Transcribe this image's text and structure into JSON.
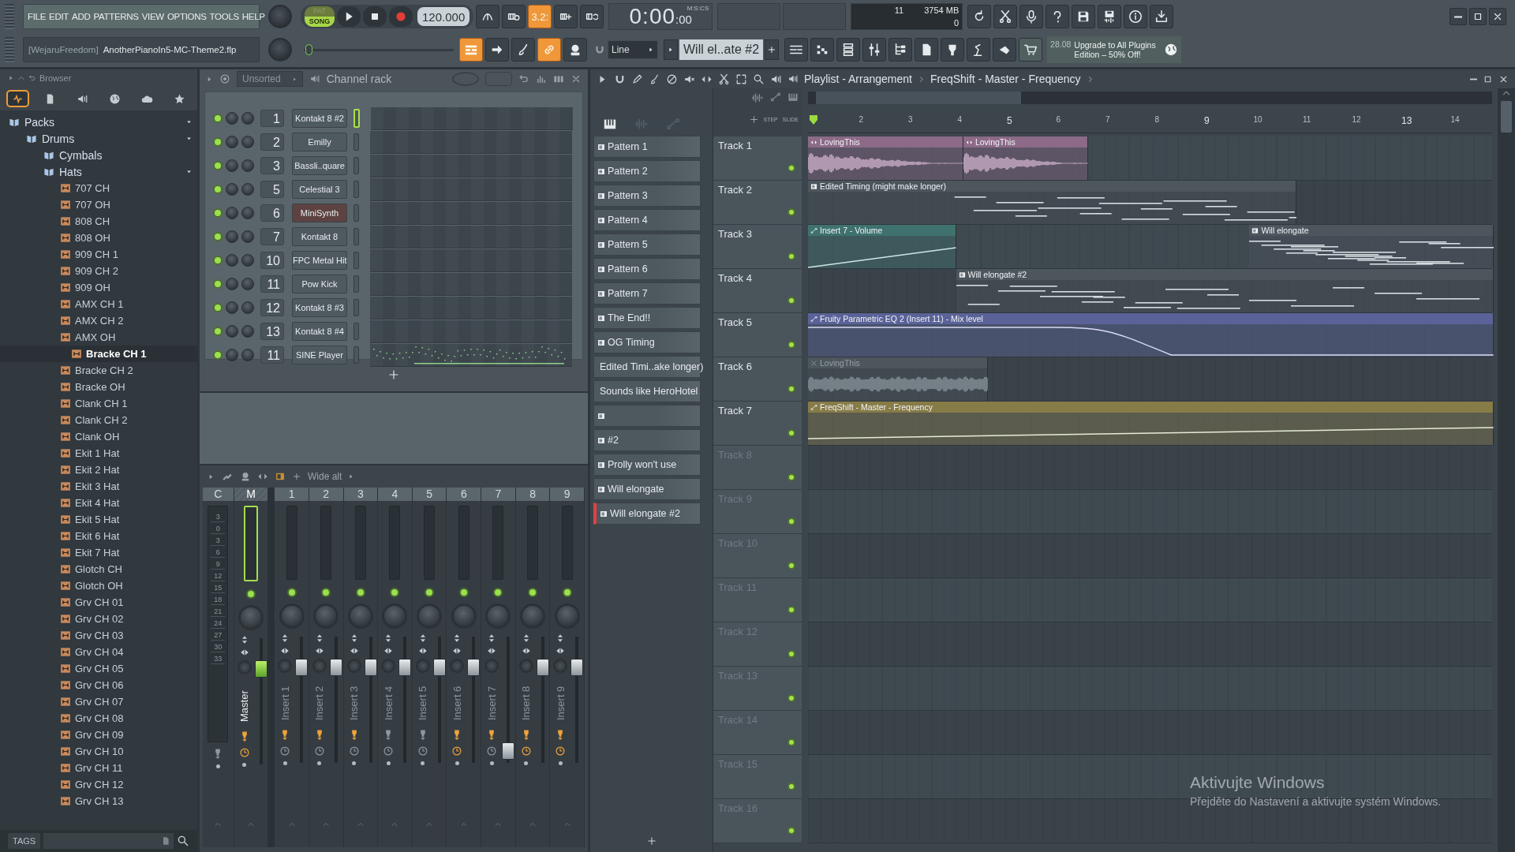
{
  "menu": [
    "FILE",
    "EDIT",
    "ADD",
    "PATTERNS",
    "VIEW",
    "OPTIONS",
    "TOOLS",
    "HELP"
  ],
  "project": {
    "author": "[WejaruFreedom]",
    "file": "AnotherPianoIn5-MC-Theme2.flp"
  },
  "transport": {
    "modes": [
      {
        "label": "PAT",
        "selected": false
      },
      {
        "label": "SONG",
        "selected": true
      }
    ],
    "tempo": "120.000"
  },
  "recording_buttons": [
    {
      "on": false
    },
    {
      "on": false
    },
    {
      "on": true,
      "label": "3.2:"
    },
    {
      "on": false
    },
    {
      "on": false
    }
  ],
  "clock": {
    "time": "0:00",
    "centiseconds": ":00",
    "format": "M:S:CS"
  },
  "monitor": {
    "cpu": "11",
    "memory": "3754 MB",
    "polyphony": "0"
  },
  "tool_buttons": [
    {
      "on": true
    },
    {
      "on": false
    },
    {
      "on": false
    },
    {
      "on": true
    },
    {
      "on": false
    }
  ],
  "snap": "Line",
  "pattern": "Will el..ate #2",
  "panel_buttons": [
    {
      "on": false
    },
    {
      "on": false
    },
    {
      "on": false
    },
    {
      "on": false
    },
    {
      "on": false
    },
    {
      "on": false
    },
    {
      "on": false
    },
    {
      "on": false
    },
    {
      "on": false
    },
    {
      "on": true
    }
  ],
  "news": {
    "date": "28.08",
    "text": "Upgrade to All Plugins Edition – 50% Off!"
  },
  "browser": {
    "title": "Browser",
    "tabs": [
      {
        "selected": true
      },
      {
        "selected": false
      },
      {
        "selected": false
      },
      {
        "selected": false
      },
      {
        "selected": false
      },
      {
        "selected": false
      }
    ],
    "tree": [
      {
        "label": "Packs",
        "kind": "folder",
        "expanded": true,
        "children": [
          {
            "label": "Drums",
            "kind": "folder",
            "expanded": true,
            "children": [
              {
                "label": "Cymbals",
                "kind": "folder",
                "expanded": false
              },
              {
                "label": "Hats",
                "kind": "folder",
                "expanded": true,
                "children": [
                  {
                    "label": "707 CH",
                    "kind": "file",
                    "selected": false
                  },
                  {
                    "label": "707 OH",
                    "kind": "file",
                    "selected": false
                  },
                  {
                    "label": "808 CH",
                    "kind": "file",
                    "selected": false
                  },
                  {
                    "label": "808 OH",
                    "kind": "file",
                    "selected": false
                  },
                  {
                    "label": "909 CH 1",
                    "kind": "file",
                    "selected": false
                  },
                  {
                    "label": "909 CH 2",
                    "kind": "file",
                    "selected": false
                  },
                  {
                    "label": "909 OH",
                    "kind": "file",
                    "selected": false
                  },
                  {
                    "label": "AMX CH 1",
                    "kind": "file",
                    "selected": false
                  },
                  {
                    "label": "AMX CH 2",
                    "kind": "file",
                    "selected": false
                  },
                  {
                    "label": "AMX OH",
                    "kind": "file",
                    "selected": false
                  },
                  {
                    "label": "Bracke CH 1",
                    "kind": "file",
                    "selected": true
                  },
                  {
                    "label": "Bracke CH 2",
                    "kind": "file",
                    "selected": false
                  },
                  {
                    "label": "Bracke OH",
                    "kind": "file",
                    "selected": false
                  },
                  {
                    "label": "Clank CH 1",
                    "kind": "file",
                    "selected": false
                  },
                  {
                    "label": "Clank CH 2",
                    "kind": "file",
                    "selected": false
                  },
                  {
                    "label": "Clank OH",
                    "kind": "file",
                    "selected": false
                  },
                  {
                    "label": "Ekit 1 Hat",
                    "kind": "file",
                    "selected": false
                  },
                  {
                    "label": "Ekit 2 Hat",
                    "kind": "file",
                    "selected": false
                  },
                  {
                    "label": "Ekit 3 Hat",
                    "kind": "file",
                    "selected": false
                  },
                  {
                    "label": "Ekit 4 Hat",
                    "kind": "file",
                    "selected": false
                  },
                  {
                    "label": "Ekit 5 Hat",
                    "kind": "file",
                    "selected": false
                  },
                  {
                    "label": "Ekit 6 Hat",
                    "kind": "file",
                    "selected": false
                  },
                  {
                    "label": "Ekit 7 Hat",
                    "kind": "file",
                    "selected": false
                  },
                  {
                    "label": "Glotch CH",
                    "kind": "file",
                    "selected": false
                  },
                  {
                    "label": "Glotch OH",
                    "kind": "file",
                    "selected": false
                  },
                  {
                    "label": "Grv CH 01",
                    "kind": "file",
                    "selected": false
                  },
                  {
                    "label": "Grv CH 02",
                    "kind": "file",
                    "selected": false
                  },
                  {
                    "label": "Grv CH 03",
                    "kind": "file",
                    "selected": false
                  },
                  {
                    "label": "Grv CH 04",
                    "kind": "file",
                    "selected": false
                  },
                  {
                    "label": "Grv CH 05",
                    "kind": "file",
                    "selected": false
                  },
                  {
                    "label": "Grv CH 06",
                    "kind": "file",
                    "selected": false
                  },
                  {
                    "label": "Grv CH 07",
                    "kind": "file",
                    "selected": false
                  },
                  {
                    "label": "Grv CH 08",
                    "kind": "file",
                    "selected": false
                  },
                  {
                    "label": "Grv CH 09",
                    "kind": "file",
                    "selected": false
                  },
                  {
                    "label": "Grv CH 10",
                    "kind": "file",
                    "selected": false
                  },
                  {
                    "label": "Grv CH 11",
                    "kind": "file",
                    "selected": false
                  },
                  {
                    "label": "Grv CH 12",
                    "kind": "file",
                    "selected": false
                  },
                  {
                    "label": "Grv CH 13",
                    "kind": "file",
                    "selected": false
                  }
                ]
              }
            ]
          }
        ]
      }
    ],
    "tags_label": "TAGS"
  },
  "channel_rack": {
    "title": "Channel rack",
    "filter": "Unsorted",
    "channels": [
      {
        "number": "1",
        "name": "Kontakt 8 #2",
        "on": true,
        "selected": true,
        "color": "#4f5960"
      },
      {
        "number": "2",
        "name": "Emilly",
        "on": true,
        "selected": false,
        "color": "#4f5960"
      },
      {
        "number": "3",
        "name": "Bassli..quare",
        "on": true,
        "selected": false,
        "color": "#4f5960"
      },
      {
        "number": "5",
        "name": "Celestial 3",
        "on": true,
        "selected": false,
        "color": "#4f5960"
      },
      {
        "number": "6",
        "name": "MiniSynth",
        "on": true,
        "selected": false,
        "color": "#5e4241"
      },
      {
        "number": "7",
        "name": "Kontakt 8",
        "on": true,
        "selected": false,
        "color": "#4f5960"
      },
      {
        "number": "10",
        "name": "FPC Metal Hit",
        "on": true,
        "selected": false,
        "color": "#4f5960"
      },
      {
        "number": "11",
        "name": "Pow Kick",
        "on": true,
        "selected": false,
        "color": "#4f5960"
      },
      {
        "number": "12",
        "name": "Kontakt 8 #3",
        "on": true,
        "selected": false,
        "color": "#4f5960"
      },
      {
        "number": "13",
        "name": "Kontakt 8 #4",
        "on": true,
        "selected": false,
        "color": "#4f5960"
      },
      {
        "number": "11",
        "name": "SINE Player",
        "on": true,
        "selected": false,
        "color": "#4f5960",
        "kind": "notes"
      }
    ]
  },
  "mixer": {
    "preset": "Wide alt",
    "scale": [
      "3",
      "0",
      "3",
      "6",
      "9",
      "12",
      "15",
      "18",
      "21",
      "24",
      "27",
      "30",
      "33"
    ],
    "tracks": [
      {
        "label": "C",
        "kind": "current",
        "selected": false,
        "fx_on": false
      },
      {
        "label": "M",
        "name": "Master",
        "kind": "master",
        "selected": true,
        "level": 0.8,
        "fx_on": true,
        "clock_on": true
      },
      {
        "label": "1",
        "name": "Insert 1",
        "kind": "insert",
        "selected": false,
        "level": 0.8,
        "fx_on": true,
        "clock_on": false
      },
      {
        "label": "2",
        "name": "Insert 2",
        "kind": "insert",
        "selected": false,
        "level": 0.8,
        "fx_on": true,
        "clock_on": false
      },
      {
        "label": "3",
        "name": "Insert 3",
        "kind": "insert",
        "selected": false,
        "level": 0.8,
        "fx_on": true,
        "clock_on": false
      },
      {
        "label": "4",
        "name": "Insert 4",
        "kind": "insert",
        "selected": false,
        "level": 0.8,
        "fx_on": false,
        "clock_on": false
      },
      {
        "label": "5",
        "name": "Insert 5",
        "kind": "insert",
        "selected": false,
        "level": 0.8,
        "fx_on": false,
        "clock_on": false
      },
      {
        "label": "6",
        "name": "Insert 6",
        "kind": "insert",
        "selected": false,
        "level": 0.8,
        "fx_on": true,
        "clock_on": true
      },
      {
        "label": "7",
        "name": "Insert 7",
        "kind": "insert",
        "selected": false,
        "level": 0.03,
        "fx_on": true,
        "clock_on": false
      },
      {
        "label": "8",
        "name": "Insert 8",
        "kind": "insert",
        "selected": false,
        "level": 0.8,
        "fx_on": true,
        "clock_on": true
      },
      {
        "label": "9",
        "name": "Insert 9",
        "kind": "insert",
        "selected": false,
        "level": 0.8,
        "fx_on": true,
        "clock_on": true
      }
    ]
  },
  "playlist": {
    "title": "Playlist - Arrangement",
    "target": "FreqShift - Master - Frequency",
    "step_label": "STEP",
    "slide_label": "SLIDE",
    "patterns": [
      {
        "name": "Pattern 1",
        "selected": false
      },
      {
        "name": "Pattern 2",
        "selected": false
      },
      {
        "name": "Pattern 3",
        "selected": false
      },
      {
        "name": "Pattern 4",
        "selected": false
      },
      {
        "name": "Pattern 5",
        "selected": false
      },
      {
        "name": "Pattern 6",
        "selected": false
      },
      {
        "name": "Pattern 7",
        "selected": false
      },
      {
        "name": "The End!!",
        "selected": false
      },
      {
        "name": "OG Timing",
        "selected": false
      },
      {
        "name": "Edited Timi..ake longer)",
        "selected": false
      },
      {
        "name": "Sounds like HeroHotel",
        "selected": false
      },
      {
        "selected": false
      },
      {
        "name": "#2",
        "selected": false
      },
      {
        "name": "Prolly won't use",
        "selected": false
      },
      {
        "name": "Will elongate",
        "selected": false
      },
      {
        "name": "Will elongate #2",
        "selected": true
      }
    ],
    "ruler": [
      "2",
      "3",
      "4",
      "5",
      "6",
      "7",
      "8",
      "9",
      "10",
      "11",
      "12",
      "13",
      "14"
    ],
    "tracks": [
      {
        "name": "Track 1",
        "on": true,
        "clips": [
          {
            "kind": "audio",
            "name": "LovingThis",
            "color": "#8c6a88",
            "muted": false
          },
          {
            "kind": "audio",
            "name": "LovingThis",
            "color": "#8c6a88",
            "muted": false
          }
        ]
      },
      {
        "name": "Track 2",
        "on": true,
        "clips": [
          {
            "kind": "pattern",
            "name": "Edited Timing (might make longer)",
            "color": "#4d565d",
            "muted": false
          }
        ]
      },
      {
        "name": "Track 3",
        "on": true,
        "clips": [
          {
            "kind": "automation",
            "name": "Insert 7 - Volume",
            "color": "#3f726e",
            "muted": false
          },
          {
            "kind": "pattern",
            "name": "Will elongate",
            "color": "#4d565d",
            "muted": false
          }
        ]
      },
      {
        "name": "Track 4",
        "on": true,
        "clips": [
          {
            "kind": "pattern",
            "name": "Will elongate #2",
            "color": "#4d565d",
            "muted": false
          }
        ]
      },
      {
        "name": "Track 5",
        "on": true,
        "clips": [
          {
            "kind": "automation",
            "name": "Fruity Parametric EQ 2 (Insert 11) - Mix level",
            "color": "#5a6298",
            "muted": false
          }
        ]
      },
      {
        "name": "Track 6",
        "on": true,
        "clips": [
          {
            "kind": "audio",
            "name": "LovingThis",
            "color": "#4d565d",
            "muted": true
          }
        ]
      },
      {
        "name": "Track 7",
        "on": true,
        "clips": [
          {
            "kind": "automation",
            "name": "FreqShift - Master - Frequency",
            "color": "#877b48",
            "muted": false
          }
        ]
      },
      {
        "name": "Track 8",
        "on": true
      },
      {
        "name": "Track 9",
        "on": true
      },
      {
        "name": "Track 10",
        "on": true
      },
      {
        "name": "Track 11",
        "on": true
      },
      {
        "name": "Track 12",
        "on": true
      },
      {
        "name": "Track 13",
        "on": true
      },
      {
        "name": "Track 14",
        "on": true
      },
      {
        "name": "Track 15",
        "on": true
      },
      {
        "name": "Track 16",
        "on": true
      }
    ]
  },
  "windows_notice": {
    "title": "Aktivujte Windows",
    "text": "Přejděte do Nastavení a aktivujte systém Windows."
  }
}
